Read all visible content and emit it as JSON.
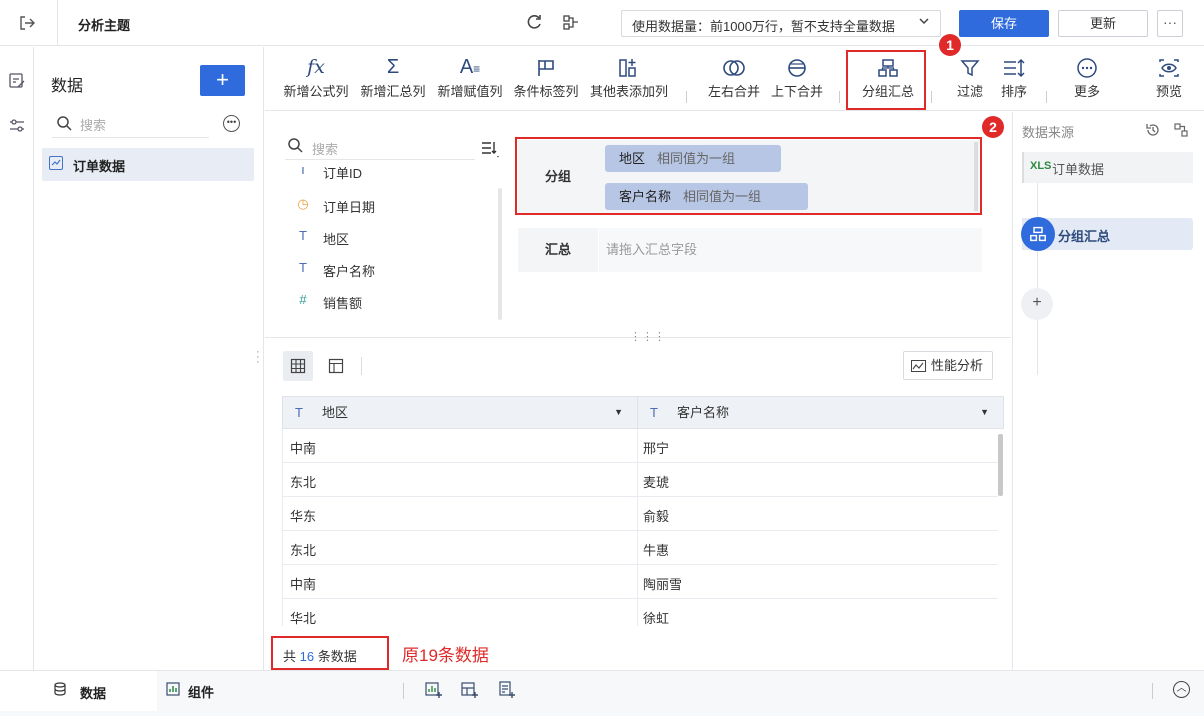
{
  "header": {
    "title": "分析主题",
    "data_limit_select": "使用数据量：前1000万行，暂不支持全量数据",
    "save_label": "保存",
    "update_label": "更新",
    "more_label": "···"
  },
  "data_panel": {
    "title": "数据",
    "add_label": "+",
    "search_placeholder": "搜索",
    "items": [
      {
        "label": "订单数据"
      }
    ]
  },
  "toolbar": {
    "items": [
      {
        "icon": "fx",
        "label": "新增公式列"
      },
      {
        "icon": "Σ",
        "label": "新增汇总列"
      },
      {
        "icon": "A≡",
        "label": "新增赋值列"
      },
      {
        "icon": "⚑",
        "label": "条件标签列"
      },
      {
        "icon": "▯±",
        "label": "其他表添加列"
      },
      {
        "icon": "◎",
        "label": "左右合并"
      },
      {
        "icon": "⊜",
        "label": "上下合并"
      },
      {
        "icon": "品",
        "label": "分组汇总"
      },
      {
        "icon": "▽",
        "label": "过滤"
      },
      {
        "icon": "≡↕",
        "label": "排序"
      },
      {
        "icon": "⋯",
        "label": "更多"
      },
      {
        "icon": "◉",
        "label": "预览"
      }
    ]
  },
  "annotations": {
    "badge1": "1",
    "badge2": "2",
    "original_count_note": "原19条数据"
  },
  "fields": {
    "search_placeholder": "搜索",
    "items": [
      {
        "type_icon": "T",
        "name": "订单ID",
        "color": "#4a6db3"
      },
      {
        "type_icon": "◷",
        "name": "订单日期",
        "color": "#e6a23c"
      },
      {
        "type_icon": "T",
        "name": "地区",
        "color": "#4a6db3"
      },
      {
        "type_icon": "T",
        "name": "客户名称",
        "color": "#4a6db3"
      },
      {
        "type_icon": "#",
        "name": "销售额",
        "color": "#2a9d8f"
      }
    ]
  },
  "group_config": {
    "group_label": "分组",
    "group_chips": [
      {
        "name": "地区",
        "mode": "相同值为一组"
      },
      {
        "name": "客户名称",
        "mode": "相同值为一组"
      }
    ],
    "summary_label": "汇总",
    "summary_placeholder": "请拖入汇总字段"
  },
  "preview": {
    "perf_label": "性能分析",
    "columns": [
      {
        "type_icon": "T",
        "name": "地区"
      },
      {
        "type_icon": "T",
        "name": "客户名称"
      }
    ],
    "rows": [
      [
        "中南",
        "邢宁"
      ],
      [
        "东北",
        "麦琥"
      ],
      [
        "华东",
        "俞毅"
      ],
      [
        "东北",
        "牛惠"
      ],
      [
        "中南",
        "陶丽雪"
      ],
      [
        "华北",
        "徐虹"
      ]
    ],
    "count_prefix": "共",
    "count_value": "16",
    "count_suffix": "条数据"
  },
  "source_panel": {
    "title": "数据来源",
    "source_icon": "XLS",
    "source_label": "订单数据",
    "step_label": "分组汇总",
    "add_step": "+"
  },
  "bottom_bar": {
    "data_tab": "数据",
    "component_tab": "组件"
  },
  "colors": {
    "primary": "#2f6bdc",
    "highlight_red": "#e02a2a",
    "chip_bg": "#b7c6e4"
  }
}
